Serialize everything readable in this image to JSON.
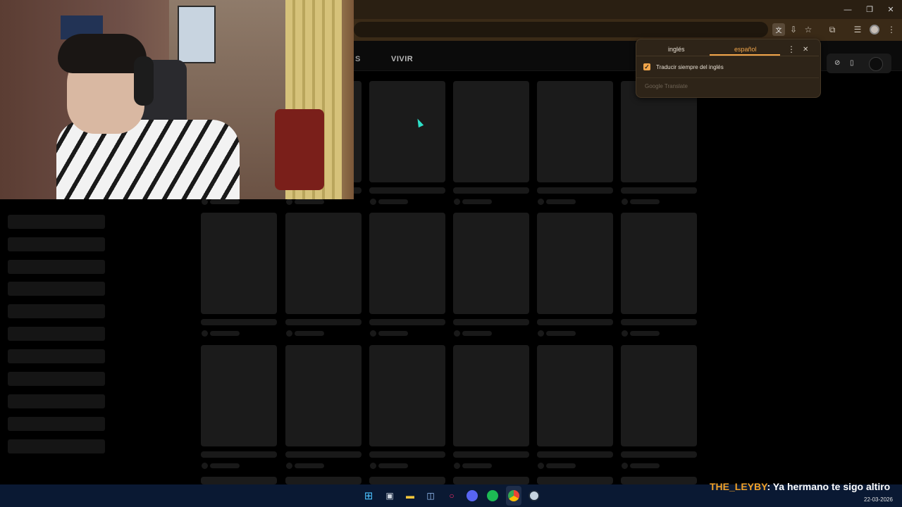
{
  "browser": {
    "window_controls": {
      "minimize": "—",
      "restore": "❐",
      "close": "✕"
    }
  },
  "site": {
    "nav": {
      "partial_label": "S",
      "vivir_label": "VIVIR"
    }
  },
  "translate_popup": {
    "tab_source": "inglés",
    "tab_target": "español",
    "more_icon": "⋮",
    "close_icon": "✕",
    "checkbox_checked": true,
    "checkbox_label": "Traducir siempre del inglés",
    "footer": "Google Translate"
  },
  "chat_overlay": {
    "username": "THE_LEYBY",
    "message": ": Ya hermano te sigo altiro"
  },
  "taskbar": {
    "date": "22-03-2026",
    "time": "0:11",
    "apps": [
      "windows-start",
      "task-view",
      "file-explorer",
      "microsoft-store",
      "opera-gx",
      "discord",
      "spotify",
      "chrome",
      "steam"
    ]
  },
  "colors": {
    "accent": "#f1a54a",
    "chat_user": "#f0a127",
    "taskbar": "#0a1933"
  }
}
